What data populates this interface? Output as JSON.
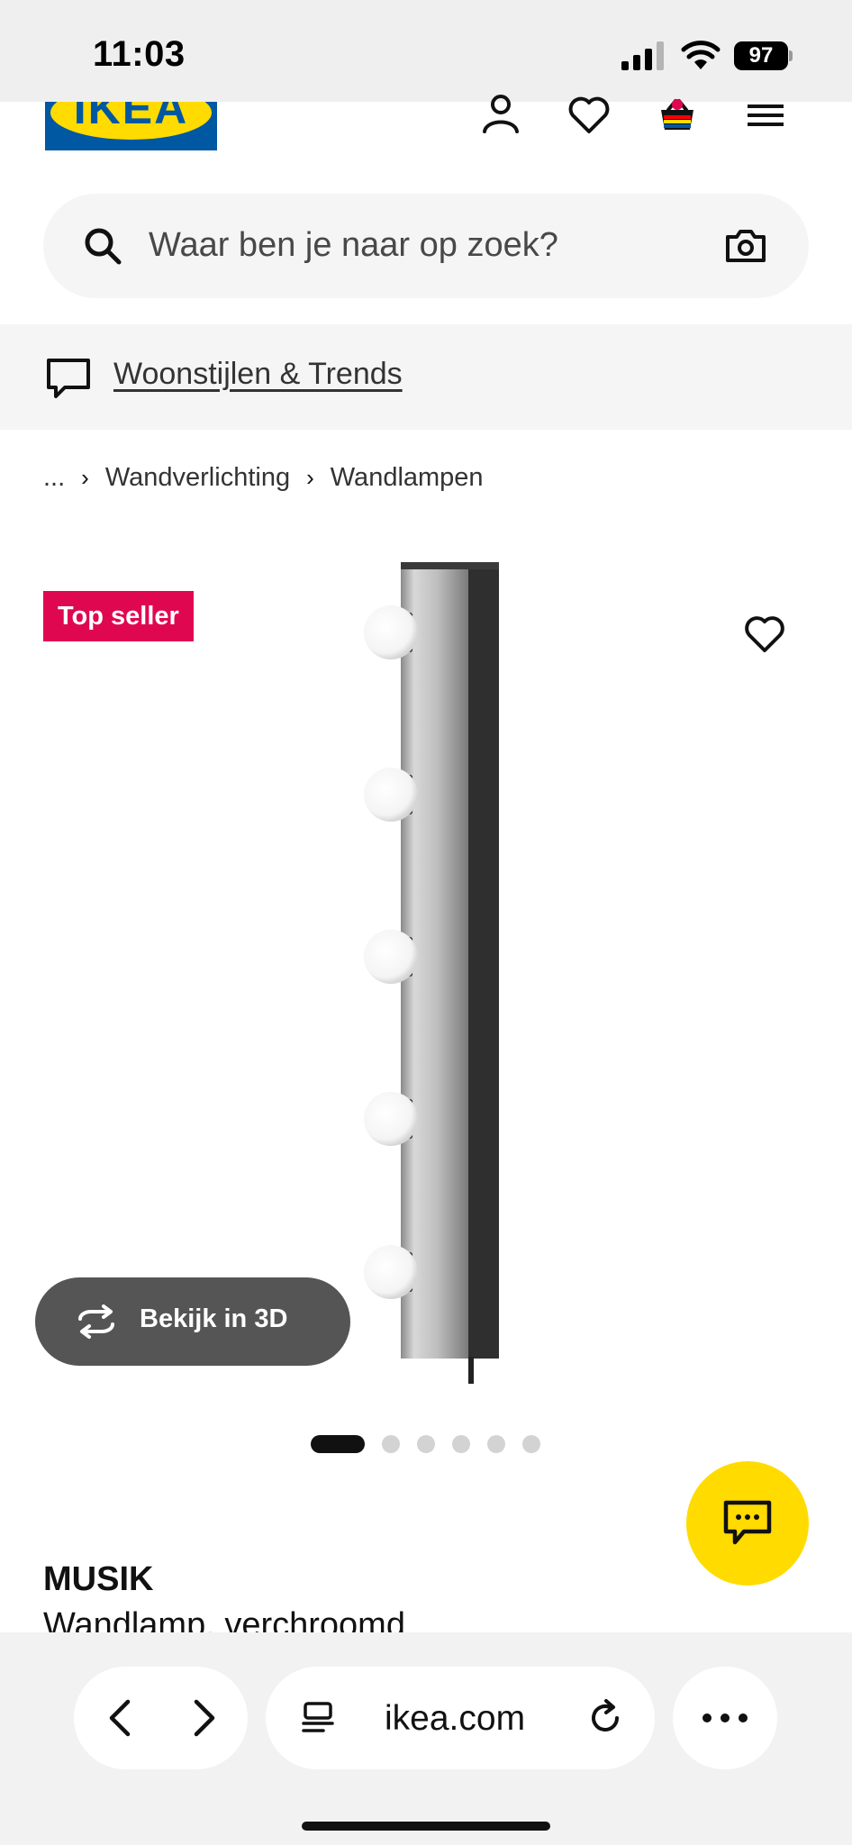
{
  "status_bar": {
    "time": "11:03",
    "battery": "97"
  },
  "header": {
    "logo_text": "IKEA",
    "icons": [
      "account-icon",
      "wishlist-heart-icon",
      "shopping-bag-icon",
      "menu-icon"
    ]
  },
  "search": {
    "placeholder": "Waar ben je naar op zoek?"
  },
  "banner": {
    "link_label": "Woonstijlen & Trends"
  },
  "breadcrumb": {
    "ellipsis": "...",
    "items": [
      "Wandverlichting",
      "Wandlampen"
    ]
  },
  "product": {
    "badge": "Top seller",
    "view_3d_label": "Bekijk in 3D",
    "carousel": {
      "total": 6,
      "active_index": 1
    },
    "name": "MUSIK",
    "description": "Wandlamp, verchroomd"
  },
  "browser": {
    "url": "ikea.com"
  },
  "colors": {
    "ikea_blue": "#0058a3",
    "ikea_yellow": "#ffdb00",
    "badge_red": "#e00751",
    "view3d_bg": "#555555"
  }
}
